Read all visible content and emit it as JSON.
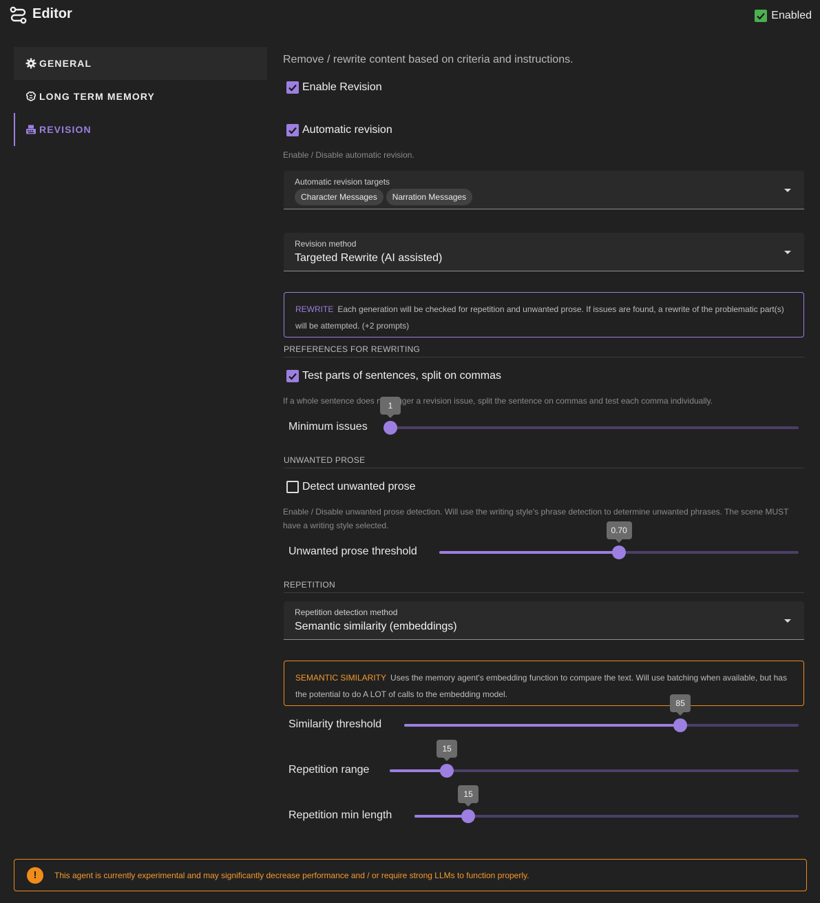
{
  "header": {
    "title": "Editor",
    "enabled_label": "Enabled",
    "enabled": true
  },
  "sidebar": {
    "items": [
      {
        "label": "GENERAL",
        "icon": "gear-icon"
      },
      {
        "label": "LONG TERM MEMORY",
        "icon": "brain-icon"
      },
      {
        "label": "REVISION",
        "icon": "typewriter-icon"
      }
    ]
  },
  "main": {
    "description": "Remove / rewrite content based on criteria and instructions.",
    "enable_revision": {
      "label": "Enable Revision",
      "checked": true
    },
    "automatic_revision": {
      "label": "Automatic revision",
      "checked": true,
      "hint": "Enable / Disable automatic revision."
    },
    "targets": {
      "label": "Automatic revision targets",
      "chips": [
        "Character Messages",
        "Narration Messages"
      ]
    },
    "revision_method": {
      "label": "Revision method",
      "value": "Targeted Rewrite (AI assisted)"
    },
    "rewrite_alert": {
      "tag": "REWRITE",
      "text": "Each generation will be checked for repetition and unwanted prose. If issues are found, a rewrite of the problematic part(s) will be attempted. (+2 prompts)"
    },
    "preferences": {
      "heading": "PREFERENCES FOR REWRITING",
      "split_commas": {
        "label": "Test parts of sentences, split on commas",
        "checked": true,
        "hint": "If a whole sentence does not trigger a revision issue, split the sentence on commas and test each comma individually."
      },
      "min_issues": {
        "label": "Minimum issues",
        "value": "1",
        "fraction": 0.0
      }
    },
    "unwanted_prose": {
      "heading": "UNWANTED PROSE",
      "detect": {
        "label": "Detect unwanted prose",
        "checked": false,
        "hint": "Enable / Disable unwanted prose detection. Will use the writing style's phrase detection to determine unwanted phrases. The scene MUST have a writing style selected."
      },
      "threshold": {
        "label": "Unwanted prose threshold",
        "value": "0.70",
        "fraction": 0.5
      }
    },
    "repetition": {
      "heading": "REPETITION",
      "method": {
        "label": "Repetition detection method",
        "value": "Semantic similarity (embeddings)"
      },
      "alert": {
        "tag": "SEMANTIC SIMILARITY",
        "text": "Uses the memory agent's embedding function to compare the text. Will use batching when available, but has the potential to do A LOT of calls to the embedding model."
      },
      "similarity": {
        "label": "Similarity threshold",
        "value": "85",
        "fraction": 0.7
      },
      "range": {
        "label": "Repetition range",
        "value": "15",
        "fraction": 0.14
      },
      "min_length": {
        "label": "Repetition min length",
        "value": "15",
        "fraction": 0.14
      }
    }
  },
  "footer": {
    "warning": "This agent is currently experimental and may significantly decrease performance and / or require strong LLMs to function properly.",
    "icon": "exclamation-icon"
  },
  "colors": {
    "accent": "#9c7fe0",
    "success": "#4caf50",
    "warning": "#f08c1a"
  }
}
